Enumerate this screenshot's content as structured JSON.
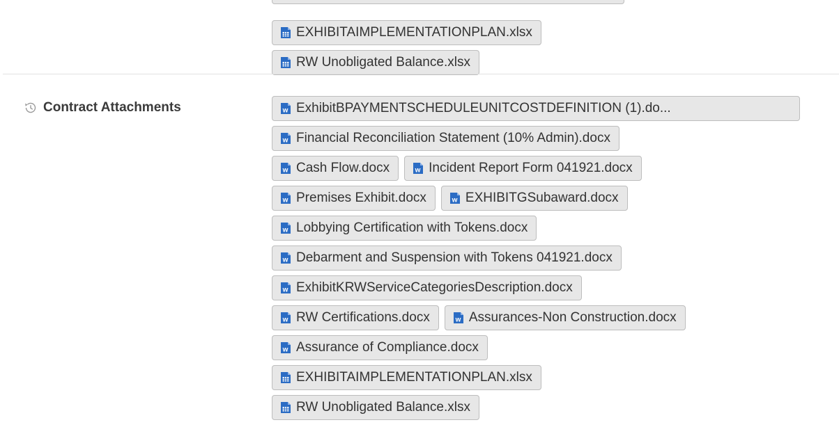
{
  "upper_files": {
    "rows": [
      [
        {
          "name": "EXHIBITAIMPLEMENTATIONPLAN.xlsx",
          "icon": "excel-file-icon"
        }
      ],
      [
        {
          "name": "RW Unobligated Balance.xlsx",
          "icon": "excel-file-icon"
        }
      ]
    ]
  },
  "contract_attachments": {
    "label": "Contract Attachments",
    "label_icon": "history-icon",
    "rows": [
      [
        {
          "name": "ExhibitBPAYMENTSCHEDULEUNITCOSTDEFINITION (1).do...",
          "icon": "word-file-icon"
        }
      ],
      [
        {
          "name": "Financial Reconciliation Statement (10% Admin).docx",
          "icon": "word-file-icon"
        }
      ],
      [
        {
          "name": "Cash Flow.docx",
          "icon": "word-file-icon"
        },
        {
          "name": "Incident Report Form 041921.docx",
          "icon": "word-file-icon"
        }
      ],
      [
        {
          "name": "Premises Exhibit.docx",
          "icon": "word-file-icon"
        },
        {
          "name": "EXHIBITGSubaward.docx",
          "icon": "word-file-icon"
        }
      ],
      [
        {
          "name": "Lobbying Certification with Tokens.docx",
          "icon": "word-file-icon"
        }
      ],
      [
        {
          "name": "Debarment and Suspension with Tokens 041921.docx",
          "icon": "word-file-icon"
        }
      ],
      [
        {
          "name": "ExhibitKRWServiceCategoriesDescription.docx",
          "icon": "word-file-icon"
        }
      ],
      [
        {
          "name": "RW Certifications.docx",
          "icon": "word-file-icon"
        },
        {
          "name": "Assurances-Non Construction.docx",
          "icon": "word-file-icon"
        }
      ],
      [
        {
          "name": "Assurance of Compliance.docx",
          "icon": "word-file-icon"
        }
      ],
      [
        {
          "name": "EXHIBITAIMPLEMENTATIONPLAN.xlsx",
          "icon": "excel-file-icon"
        }
      ],
      [
        {
          "name": "RW Unobligated Balance.xlsx",
          "icon": "excel-file-icon"
        }
      ]
    ]
  },
  "colors": {
    "chip_bg": "#e7e7e7",
    "chip_border": "#bdbdbd",
    "word_icon": "#2b6cc4",
    "excel_icon": "#2b6cc4",
    "label_text": "#3a3a3a"
  }
}
